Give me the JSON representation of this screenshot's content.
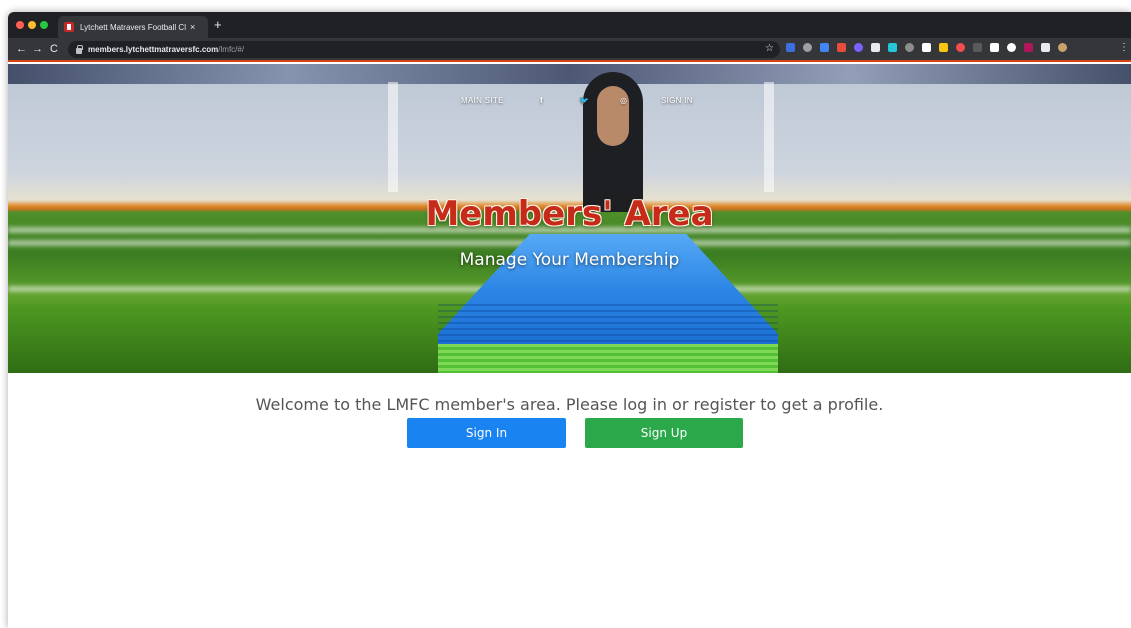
{
  "browser": {
    "tab_title": "Lytchett Matravers Football Cl",
    "tab_close": "×",
    "new_tab": "+",
    "nav": {
      "back": "←",
      "forward": "→",
      "reload": "C"
    },
    "url_host": "members.lytchettmatraversfc.com",
    "url_path": "/lmfc/#/",
    "star": "☆",
    "menu": "⋮",
    "extensions": [
      {
        "icon": "extension-icon",
        "color": "#3b6fe0"
      },
      {
        "icon": "extension-icon",
        "color": "#9aa0a6"
      },
      {
        "icon": "extension-icon",
        "color": "#4285f4"
      },
      {
        "icon": "extension-icon",
        "color": "#e84c3d"
      },
      {
        "icon": "extension-icon",
        "color": "#7b61ff"
      },
      {
        "icon": "extension-icon",
        "color": "#e8eaed"
      },
      {
        "icon": "extension-icon",
        "color": "#26c6da"
      },
      {
        "icon": "extension-icon",
        "color": "#8d8d8d"
      },
      {
        "icon": "extension-icon",
        "color": "#ffffff"
      },
      {
        "icon": "extension-icon",
        "color": "#f9c513"
      },
      {
        "icon": "extension-icon",
        "color": "#f24e4e"
      },
      {
        "icon": "extension-icon",
        "color": "#5a5a5a"
      },
      {
        "icon": "extension-icon",
        "color": "#ffffff"
      },
      {
        "icon": "extension-icon",
        "color": "#ffffff"
      },
      {
        "icon": "extension-icon",
        "color": "#b0165b"
      },
      {
        "icon": "puzzle-icon",
        "color": "#e8eaed"
      },
      {
        "icon": "profile-icon",
        "color": "#c9a26b"
      }
    ]
  },
  "site_nav": {
    "main_site": "MAIN SITE",
    "facebook": "f",
    "twitter": "🐦",
    "instagram": "◎",
    "sign_in": "SIGN IN"
  },
  "hero": {
    "title": "Members' Area",
    "subtitle": "Manage Your Membership"
  },
  "main": {
    "welcome": "Welcome to the LMFC member's area. Please log in or register to get a profile.",
    "sign_in_label": "Sign In",
    "sign_up_label": "Sign Up"
  },
  "colors": {
    "title_red": "#c62b1a",
    "sign_in_blue": "#1a83f2",
    "sign_up_green": "#2aa84a",
    "toolbar_accent": "#d84315"
  }
}
